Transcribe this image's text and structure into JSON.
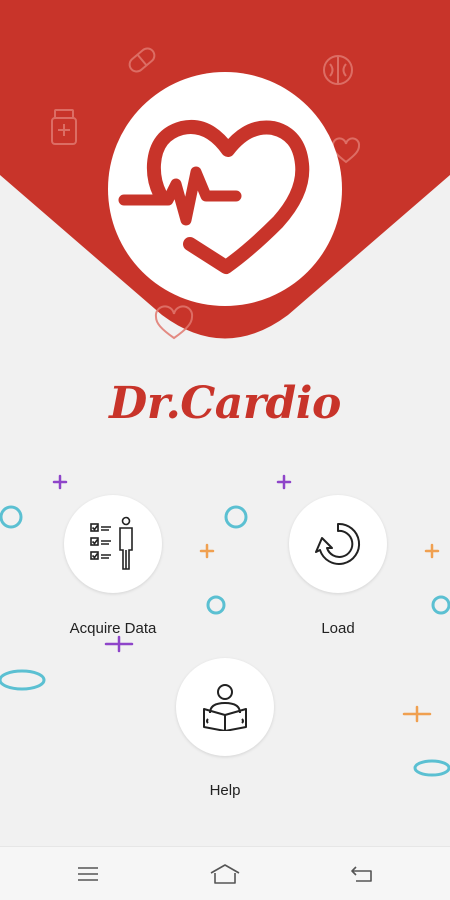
{
  "app": {
    "title": "Dr.Cardio"
  },
  "colors": {
    "brand_red": "#c8342a",
    "background": "#f1f1f1",
    "teal_ring": "#5bc0d2",
    "purple_plus": "#8e44c9",
    "orange_plus": "#f0a050"
  },
  "menu": {
    "acquire": {
      "label": "Acquire Data",
      "icon": "checklist-person-icon"
    },
    "load": {
      "label": "Load",
      "icon": "reload-icon"
    },
    "help": {
      "label": "Help",
      "icon": "reading-person-icon"
    }
  },
  "navbar": {
    "items": [
      {
        "icon": "menu-icon"
      },
      {
        "icon": "home-icon"
      },
      {
        "icon": "back-icon"
      }
    ]
  }
}
